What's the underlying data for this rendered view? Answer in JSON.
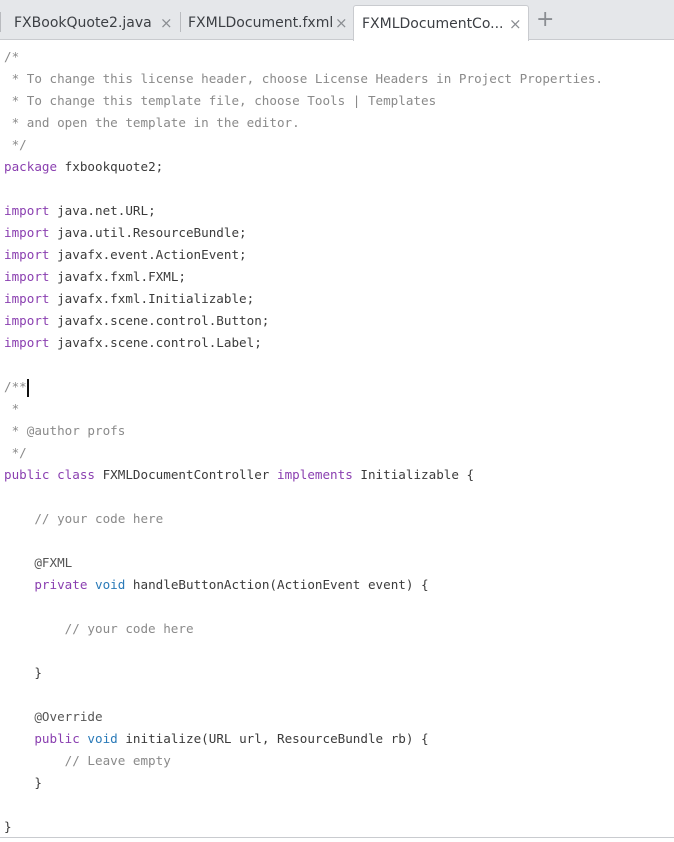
{
  "tabs": [
    {
      "label": "FXBookQuote2.java",
      "active": false
    },
    {
      "label": "FXMLDocument.fxml",
      "active": false
    },
    {
      "label": "FXMLDocumentCo...",
      "active": true
    }
  ],
  "icons": {
    "close": "×",
    "new_tab": "+"
  },
  "code": {
    "l1": "/*",
    "l2": " * To change this license header, choose License Headers in Project Properties.",
    "l3": " * To change this template file, choose Tools | Templates",
    "l4": " * and open the template in the editor.",
    "l5": " */",
    "l6_kw": "package",
    "l6_rest": " fxbookquote2;",
    "imports_kw": "import",
    "imports": [
      " java.net.URL;",
      " java.util.ResourceBundle;",
      " javafx.event.ActionEvent;",
      " javafx.fxml.FXML;",
      " javafx.fxml.Initializable;",
      " javafx.scene.control.Button;",
      " javafx.scene.control.Label;"
    ],
    "doc1": "/**",
    "doc2": " *",
    "doc3": " * @author profs",
    "doc4": " */",
    "cls_public": "public",
    "cls_class": " class",
    "cls_name": " FXMLDocumentController ",
    "cls_impl": "implements",
    "cls_rest": " Initializable {",
    "c_your1": "    // your code here",
    "ann_fxml": "    @FXML",
    "m1_private": "private",
    "m1_void": " void",
    "m1_rest": " handleButtonAction(ActionEvent event) {",
    "c_your2": "        // your code here",
    "close1": "    }",
    "ann_override": "    @Override",
    "m2_public": "public",
    "m2_void": " void",
    "m2_rest": " initialize(URL url, ResourceBundle rb) {",
    "c_leave": "        // Leave empty",
    "close2": "    }",
    "close3": "}"
  }
}
